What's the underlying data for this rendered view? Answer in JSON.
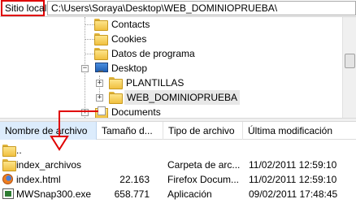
{
  "path_bar": {
    "label": "Sitio local:",
    "value": "C:\\Users\\Soraya\\Desktop\\WEB_DOMINIOPRUEBA\\"
  },
  "tree": {
    "items": [
      {
        "label": "Contacts",
        "icon": "folder-icon"
      },
      {
        "label": "Cookies",
        "icon": "folder-icon"
      },
      {
        "label": "Datos de programa",
        "icon": "folder-icon"
      },
      {
        "label": "Desktop",
        "icon": "desktop-icon",
        "expander": "−"
      },
      {
        "label": "PLANTILLAS",
        "icon": "folder-icon",
        "expander": "+"
      },
      {
        "label": "WEB_DOMINIOPRUEBA",
        "icon": "folder-icon",
        "expander": "+"
      },
      {
        "label": "Documents",
        "icon": "documents-folder-icon",
        "expander": "+"
      }
    ]
  },
  "file_list": {
    "columns": [
      "Nombre de archivo",
      "Tamaño d...",
      "Tipo de archivo",
      "Última modificación"
    ],
    "rows": [
      {
        "name": "..",
        "size": "",
        "type": "",
        "date": "",
        "icon": "folder-icon"
      },
      {
        "name": "index_archivos",
        "size": "",
        "type": "Carpeta de arc...",
        "date": "11/02/2011 12:59:10",
        "icon": "folder-icon"
      },
      {
        "name": "index.html",
        "size": "22.163",
        "type": "Firefox Docum...",
        "date": "11/02/2011 12:59:10",
        "icon": "firefox-icon"
      },
      {
        "name": "MWSnap300.exe",
        "size": "658.771",
        "type": "Aplicación",
        "date": "09/02/2011 17:48:45",
        "icon": "exe-icon"
      }
    ]
  },
  "colors": {
    "highlight_red": "#e00000",
    "sorted_column_bg": "#dcecfc",
    "folder_yellow": "#f0c040"
  }
}
